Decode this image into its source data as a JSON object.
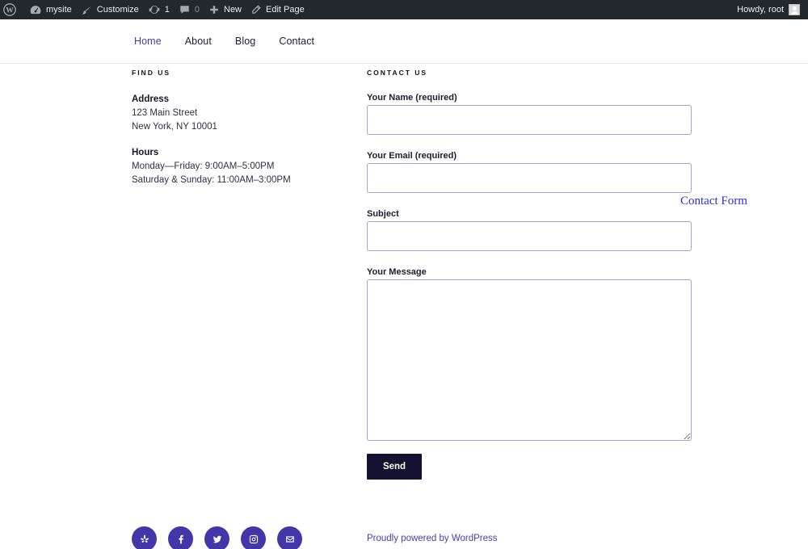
{
  "admin_bar": {
    "site_name": "mysite",
    "customize": "Customize",
    "updates_count": "1",
    "comments_count": "0",
    "new_label": "New",
    "edit_page": "Edit Page",
    "howdy": "Howdy, root"
  },
  "nav": {
    "items": [
      {
        "label": "Home",
        "active": true
      },
      {
        "label": "About"
      },
      {
        "label": "Blog"
      },
      {
        "label": "Contact"
      }
    ]
  },
  "find_us": {
    "title": "Find Us",
    "address_heading": "Address",
    "address_line1": "123 Main Street",
    "address_line2": "New York, NY 10001",
    "hours_heading": "Hours",
    "hours_line1": "Monday—Friday: 9:00AM–5:00PM",
    "hours_line2": "Saturday & Sunday: 11:00AM–3:00PM"
  },
  "contact_us": {
    "title": "Contact Us",
    "fields": [
      {
        "label": "Your Name (required)",
        "value": ""
      },
      {
        "label": "Your Email (required)",
        "value": ""
      },
      {
        "label": "Subject",
        "value": ""
      },
      {
        "label": "Your Message",
        "value": ""
      }
    ],
    "submit_label": "Send"
  },
  "annotation": "Contact Form",
  "footer": {
    "social": [
      "yelp",
      "facebook",
      "twitter",
      "instagram",
      "email"
    ],
    "powered_by": "Proudly powered by WordPress"
  },
  "colors": {
    "accent": "#4236a8",
    "admin_bar_bg": "#23282d",
    "button_bg": "#141230",
    "input_border": "#a79fe0",
    "annotation": "#2a2ae0"
  }
}
